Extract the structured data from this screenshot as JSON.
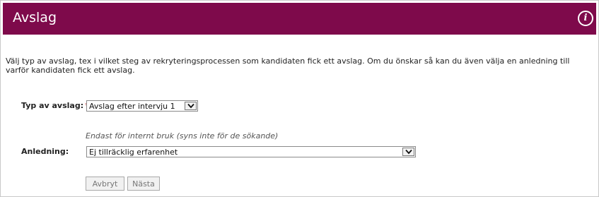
{
  "header": {
    "title": "Avslag",
    "info_icon": "info-icon",
    "color": "#7e0a4b"
  },
  "intro_text": "Välj typ av avslag, tex i vilket steg av rekryteringsprocessen som kandidaten fick ett avslag. Om du önskar så kan du även välja en anledning till varför kandidaten fick ett avslag.",
  "form": {
    "type_label": "Typ av avslag:",
    "required_marker": "*",
    "type_selected": "Avslag efter intervju 1",
    "internal_note": "Endast för internt bruk (syns inte för de sökande)",
    "reason_label": "Anledning:",
    "reason_selected": "Ej tillräcklig erfarenhet"
  },
  "buttons": {
    "cancel_label": "Avbryt",
    "next_label": "Nästa"
  }
}
